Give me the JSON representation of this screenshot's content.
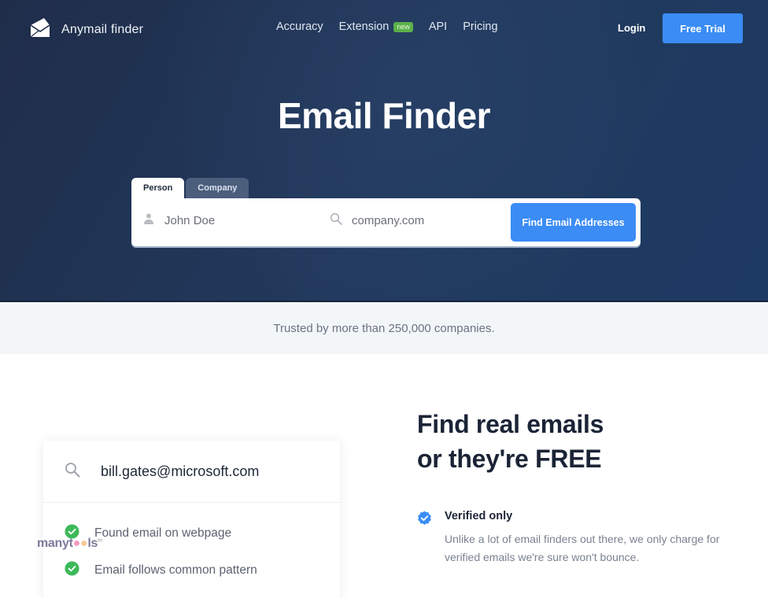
{
  "brand": {
    "name": "Anymail finder",
    "logo_icon": "envelope-icon"
  },
  "nav": {
    "items": [
      {
        "label": "Accuracy"
      },
      {
        "label": "Extension",
        "badge": "new"
      },
      {
        "label": "API"
      },
      {
        "label": "Pricing"
      }
    ],
    "login_label": "Login",
    "free_trial_label": "Free Trial"
  },
  "hero": {
    "title": "Email Finder",
    "tabs": [
      {
        "label": "Person",
        "active": true
      },
      {
        "label": "Company",
        "active": false
      }
    ],
    "person_placeholder": "John Doe",
    "company_placeholder": "company.com",
    "find_button_label": "Find Email Addresses"
  },
  "trusted_text": "Trusted by more than 250,000 companies.",
  "demo_card": {
    "email": "bill.gates@microsoft.com",
    "checks": [
      {
        "label": "Found email on webpage"
      },
      {
        "label": "Email follows common pattern"
      }
    ]
  },
  "watermark": {
    "pre": "manyt",
    "post": "ls",
    "tm": "tm"
  },
  "section": {
    "headline_line1": "Find real emails",
    "headline_line2": "or they're FREE",
    "features": [
      {
        "title": "Verified only",
        "description": "Unlike a lot of email finders out there, we only charge for verified emails we're sure won't bounce."
      }
    ]
  },
  "colors": {
    "hero_bg": "#1f2d4a",
    "accent": "#3b8cf5",
    "success": "#3cb95a",
    "badge_new": "#5ab04a"
  }
}
